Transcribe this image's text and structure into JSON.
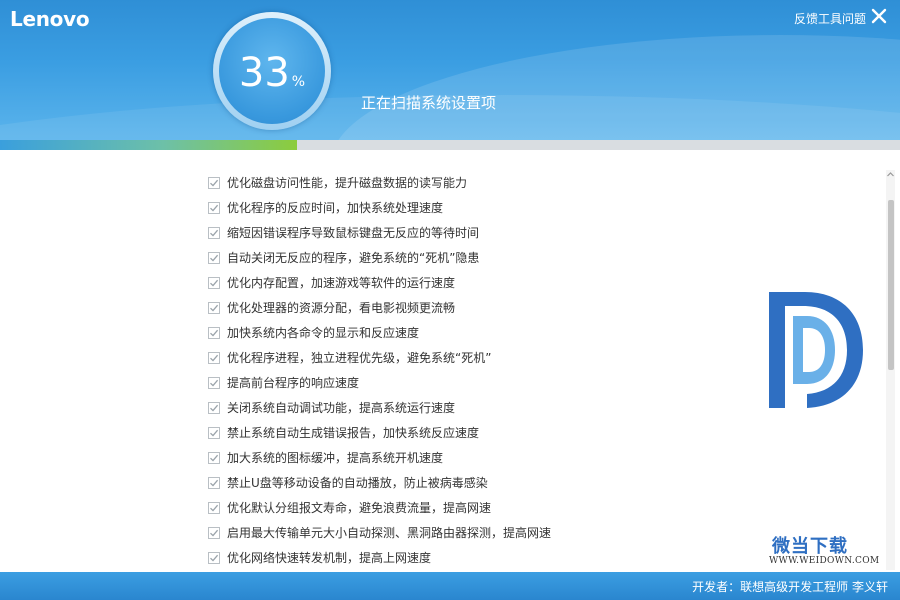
{
  "app": {
    "brand": "Lenovo",
    "feedback_label": "反馈工具问题",
    "close_icon": "close-icon"
  },
  "scan": {
    "percent_number": "33",
    "percent_symbol": "%",
    "progress_fraction": 0.33,
    "status": "正在扫描系统设置项"
  },
  "items": [
    "优化磁盘访问性能，提升磁盘数据的读写能力",
    "优化程序的反应时间，加快系统处理速度",
    "缩短因错误程序导致鼠标键盘无反应的等待时间",
    "自动关闭无反应的程序，避免系统的“死机”隐患",
    "优化内存配置，加速游戏等软件的运行速度",
    "优化处理器的资源分配，看电影视频更流畅",
    "加快系统内各命令的显示和反应速度",
    "优化程序进程，独立进程优先级，避免系统“死机”",
    "提高前台程序的响应速度",
    "关闭系统自动调试功能，提高系统运行速度",
    "禁止系统自动生成错误报告，加快系统反应速度",
    "加大系统的图标缓冲，提高系统开机速度",
    "禁止U盘等移动设备的自动播放，防止被病毒感染",
    "优化默认分组报文寿命，避免浪费流量，提高网速",
    "启用最大传输单元大小自动探测、黑洞路由器探测，提高网速",
    "优化网络快速转发机制，提高上网速度"
  ],
  "watermark": {
    "name": "微当下载",
    "url": "WWW.WEIDOWN.COM"
  },
  "footer": {
    "developer": "开发者：联想高级开发工程师 李义轩"
  },
  "colors": {
    "header_blue": "#3b9ee2",
    "progress_green": "#8ccc3c",
    "watermark_blue": "#2f6fc2"
  }
}
